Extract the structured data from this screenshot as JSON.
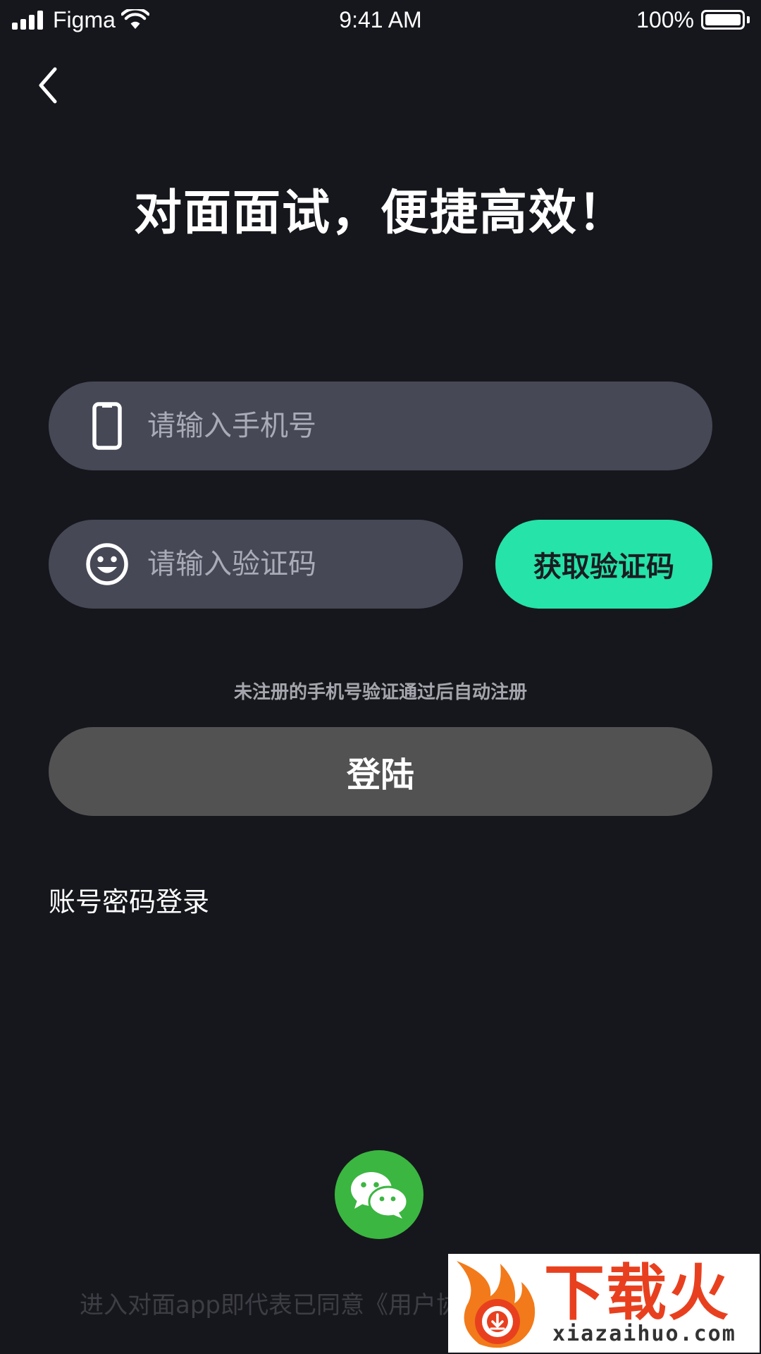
{
  "status_bar": {
    "carrier": "Figma",
    "time": "9:41 AM",
    "battery": "100%"
  },
  "header": {
    "back_icon": "chevron-left-icon"
  },
  "headline": "对面面试，便捷高效！",
  "form": {
    "phone": {
      "icon": "phone-icon",
      "placeholder": "请输入手机号",
      "value": ""
    },
    "code": {
      "icon": "smiley-icon",
      "placeholder": "请输入验证码",
      "value": ""
    },
    "get_code_label": "获取验证码",
    "hint": "未注册的手机号验证通过后自动注册",
    "login_label": "登陆"
  },
  "password_login_label": "账号密码登录",
  "wechat": {
    "icon": "wechat-icon"
  },
  "agreement_text": "进入对面app即代表已同意《用户协",
  "watermark": {
    "title": "下载火",
    "domain": "xiazaihuo.com"
  },
  "colors": {
    "background": "#16171c",
    "field": "#464856",
    "accent": "#25e3a9",
    "login_button": "#525252",
    "wechat": "#3bb641"
  }
}
